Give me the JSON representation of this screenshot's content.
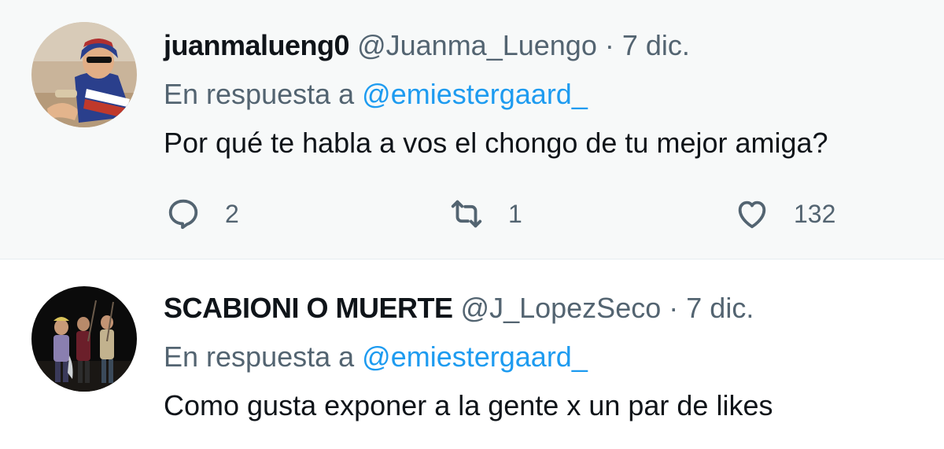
{
  "tweets": [
    {
      "display_name": "juanmalueng0",
      "handle": "@Juanma_Luengo",
      "separator": "·",
      "date": "7 dic.",
      "reply_prefix": "En respuesta a",
      "reply_to": "@emiestergaard_",
      "text": "Por qué te habla a vos el chongo de tu mejor amiga?",
      "replies": "2",
      "retweets": "1",
      "likes": "132"
    },
    {
      "display_name": "SCABIONI O MUERTE",
      "handle": "@J_LopezSeco",
      "separator": "·",
      "date": "7 dic.",
      "reply_prefix": "En respuesta a",
      "reply_to": "@emiestergaard_",
      "text": "Como gusta exponer a la gente x un par de likes"
    }
  ],
  "colors": {
    "link": "#1d9bf0",
    "secondary": "#536471",
    "primary": "#0f1419",
    "highlight_bg": "#f7f9f9"
  },
  "icons": [
    "reply-icon",
    "retweet-icon",
    "like-icon"
  ]
}
